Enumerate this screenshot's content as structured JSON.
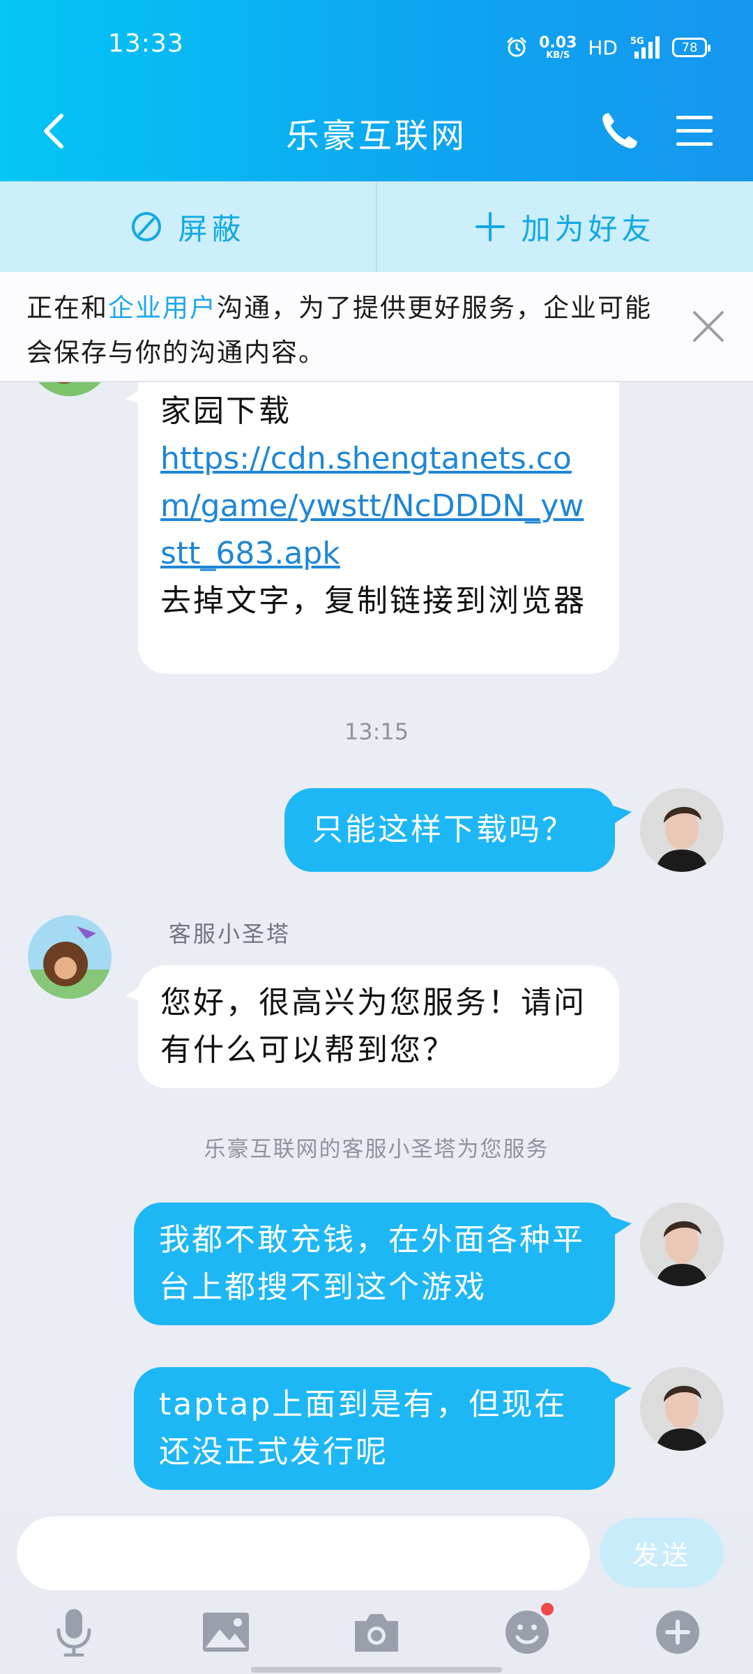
{
  "status_bar": {
    "time": "13:33",
    "net_speed_value": "0.03",
    "net_speed_unit": "KB/S",
    "hd": "HD",
    "signal": "5G",
    "battery": "78"
  },
  "header": {
    "title": "乐豪互联网"
  },
  "actions": {
    "block_label": "屏蔽",
    "add_friend_label": "加为好友"
  },
  "notice": {
    "prefix": "正在和",
    "highlight": "企业用户",
    "suffix": "沟通，为了提供更好服务，企业可能会保存与你的沟通内容。"
  },
  "messages": {
    "m1": {
      "line1": "家园下载",
      "link": "https://cdn.shengtanets.com/game/ywstt/NcDDDN_ywstt_683.apk",
      "line2": "去掉文字，复制链接到浏览器"
    },
    "time1": "13:15",
    "m2": "只能这样下载吗？",
    "sender_name": "客服小圣塔",
    "m3": "您好，很高兴为您服务！请问有什么可以帮到您？",
    "system_note": "乐豪互联网的客服小圣塔为您服务",
    "m4": "我都不敢充钱，在外面各种平台上都搜不到这个游戏",
    "m5": "taptap上面到是有，但现在还没正式发行呢"
  },
  "input": {
    "placeholder": "",
    "send_label": "发送"
  },
  "colors": {
    "header_start": "#03c6f5",
    "header_end": "#1697ee",
    "outgoing_bubble": "#1eb7f6",
    "link": "#1f86d6",
    "unread_dot": "#f24848"
  }
}
